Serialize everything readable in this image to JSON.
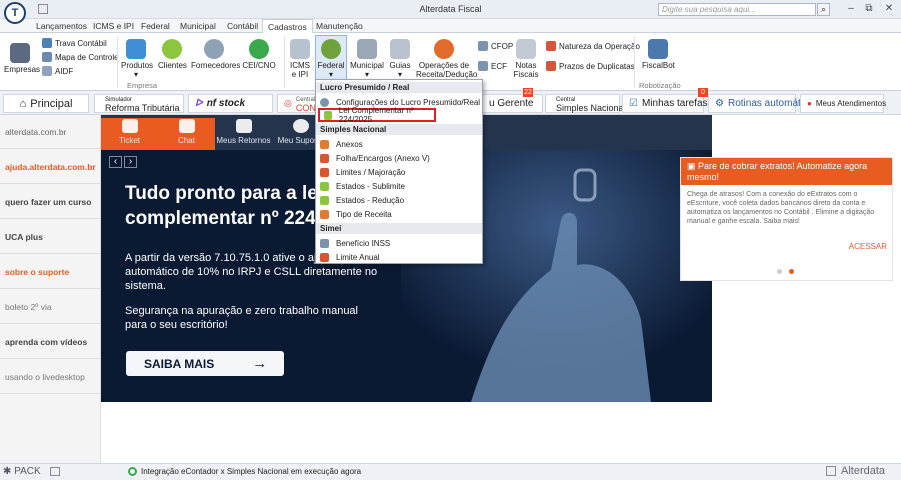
{
  "window": {
    "title": "Alterdata Fiscal",
    "logo": "T",
    "search_placeholder": "Digite sua pesquisa aqui...",
    "minimize": "‒",
    "restore": "⧉",
    "close": "✕"
  },
  "menu": {
    "tabs": [
      "Lançamentos",
      "ICMS e IPI",
      "Federal",
      "Municipal",
      "Contábil",
      "Cadastros",
      "Manutenção"
    ],
    "active": "Cadastros"
  },
  "ribbon": {
    "empresas": "Empresas",
    "trava": "Trava Contábil",
    "mapa": "Mapa de Controle",
    "aidf": "AIDF",
    "produtos": "Produtos",
    "clientes": "Clientes",
    "fornecedores": "Fornecedores",
    "cei": "CEI/CNO",
    "icms1": "ICMS",
    "icms2": "e IPI",
    "federal": "Federal",
    "municipal": "Municipal",
    "guias": "Guias",
    "operacoes1": "Operações de",
    "operacoes2": "Receita/Dedução",
    "cfop": "CFOP",
    "ecf": "ECF",
    "notas1": "Notas",
    "notas2": "Fiscais",
    "natureza": "Natureza da Operação",
    "prazos": "Prazos de Duplicatas",
    "fiscalbot": "FiscalBot",
    "group_empresa": "Empresa",
    "group_robotizacao": "Robotização"
  },
  "quickbar": {
    "principal": "Principal",
    "simulador_small": "Simulador",
    "simulador": "Reforma Tributária",
    "nfstock": "nf stock",
    "central_small": "Central",
    "con": "CON",
    "gerente": "u Gerente",
    "badge1": "22",
    "simples_small": "Central",
    "simples": "Simples Nacional",
    "tarefas": "Minhas tarefas",
    "badge2": "0",
    "rotinas": "Rotinas automáticas",
    "atendimentos": "Meus Atendimentos"
  },
  "sidebar": [
    "alterdata.com.br",
    "ajuda.alterdata.com.br",
    "quero fazer um curso",
    "UCA plus",
    "sobre o suporte",
    "boleto 2º via",
    "aprenda com vídeos",
    "usando o livedesktop"
  ],
  "shortcuts": [
    "Ticket",
    "Chat",
    "Meus Retornos",
    "Meu Suporte"
  ],
  "hero": {
    "prev": "‹",
    "next": "›",
    "title1": "Tudo pronto para a le",
    "title2": "complementar nº 224",
    "body1": "A partir da versão 7.10.75.1.0 ative o ajus",
    "body2": "automático de 10% no IRPJ e CSLL diretamente no",
    "body3": "sistema.",
    "body4": "Segurança na apuração e zero trabalho manual",
    "body5": "para o seu escritório!",
    "cta": "SAIBA MAIS",
    "cta_arrow": "→"
  },
  "card": {
    "title": "Pare de cobrar extratos! Automatize agora mesmo!",
    "body": "Chega de atrasos! Com a conexão do eExtratos com o eEscriture, você coleta dados bancários direto da conta e automatiza os lançamentos no Contábil . Elimine a digitação manual e ganhe escala. Saiba mais!",
    "action": "ACESSAR"
  },
  "dropdown": {
    "h1": "Lucro Presumido / Real",
    "i1": "Configurações do Lucro Presumido/Real",
    "i2": "Lei Complementar nº 224/2025",
    "h2": "Simples Nacional",
    "i3": "Anexos",
    "i4": "Folha/Encargos (Anexo V)",
    "i5": "Limites / Majoração",
    "i6": "Estados - Sublimite",
    "i7": "Estados - Redução",
    "i8": "Tipo de Receita",
    "h3": "Simei",
    "i9": "Benefício INSS",
    "i10": "Limite Anual"
  },
  "status": {
    "pack": "PACK",
    "message": "Integração eContador x Simples Nacional em execução agora",
    "brand": "Alterdata"
  },
  "colors": {
    "accent": "#e85c22",
    "navy": "#0b1a33",
    "highlight": "#e02020"
  }
}
